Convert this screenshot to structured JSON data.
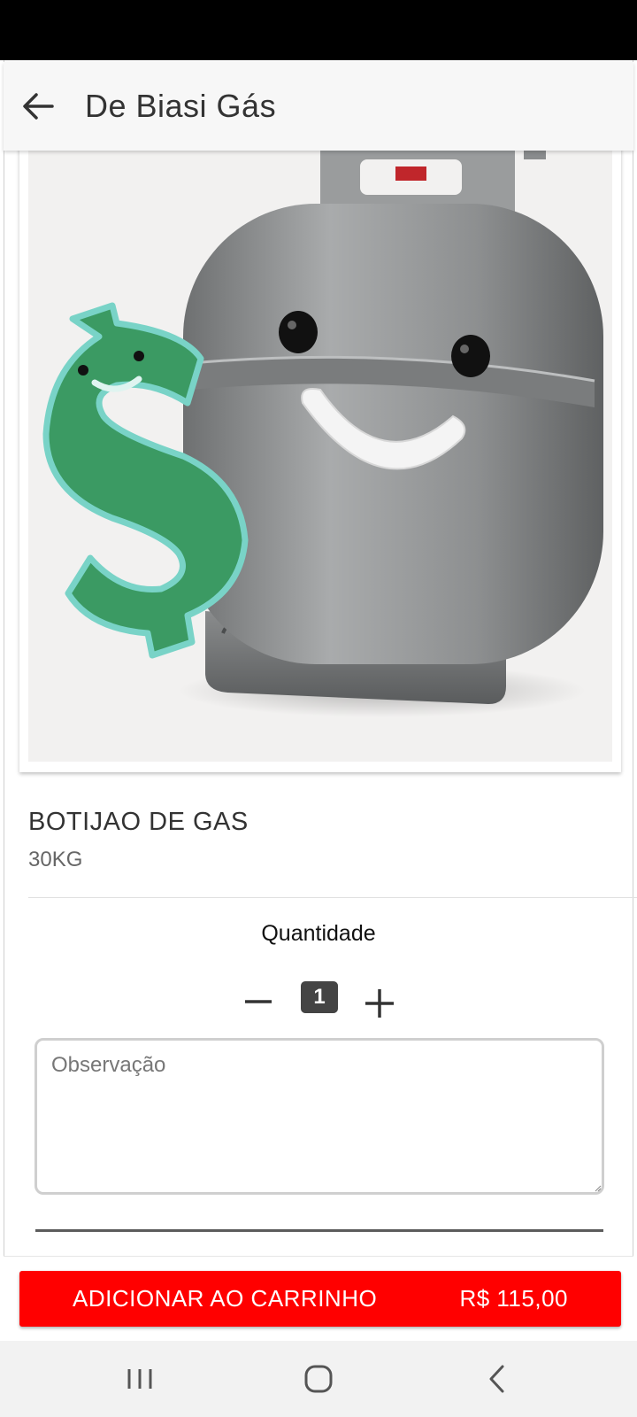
{
  "app_bar": {
    "title": "De Biasi Gás"
  },
  "icons": {
    "back": "arrow-left-icon",
    "minus": "minus-icon",
    "plus": "plus-icon",
    "recents": "recents-icon",
    "home": "home-icon",
    "nav_back": "chevron-left-icon"
  },
  "product": {
    "image_alt": "Gas cylinder mascot with dollar sign",
    "name": "BOTIJAO DE GAS",
    "subtitle": "30KG"
  },
  "quantity": {
    "label": "Quantidade",
    "value": "1"
  },
  "observation": {
    "placeholder": "Observação",
    "value": ""
  },
  "cart_button": {
    "label": "ADICIONAR AO CARRINHO",
    "price": "R$ 115,00"
  },
  "colors": {
    "accent": "#ff0000",
    "status_bar": "#000000",
    "app_bar_bg": "#f7f7f7",
    "qty_badge": "#444444",
    "dollar_green": "#3b9a63"
  }
}
